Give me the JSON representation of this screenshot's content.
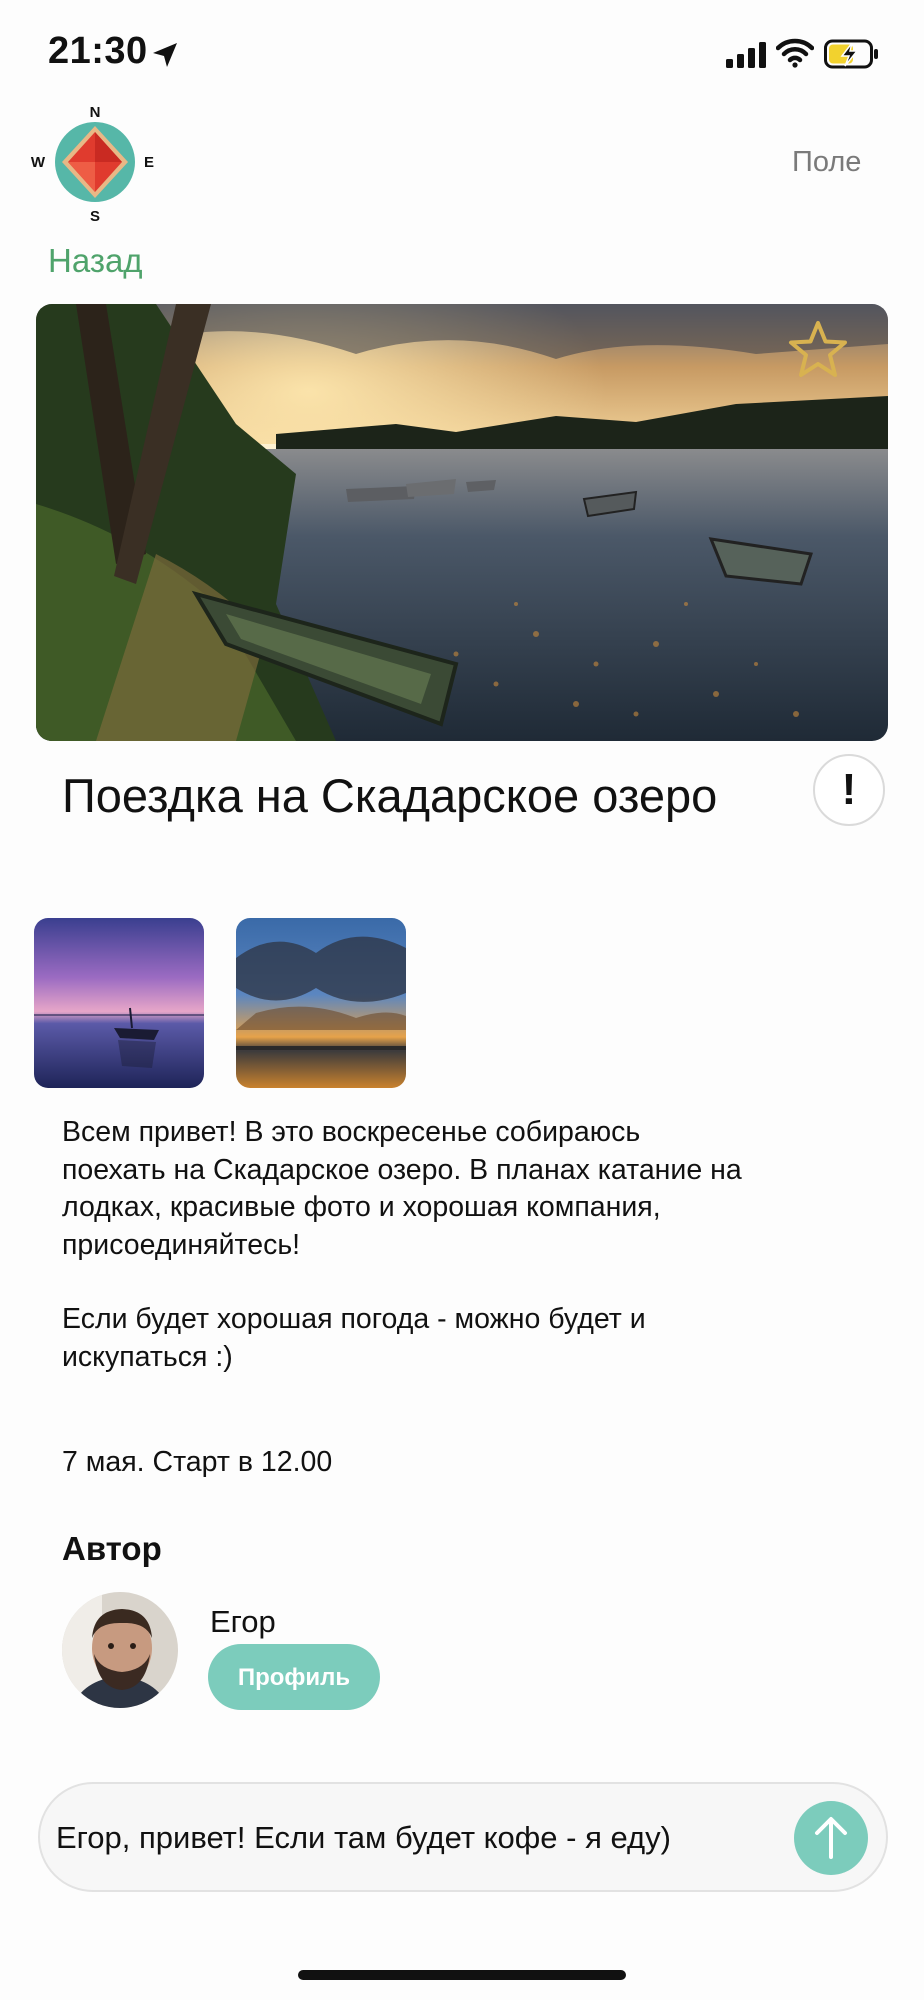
{
  "status_bar": {
    "time": "21:30",
    "location_icon": "location-arrow-icon",
    "signal_icon": "cellular-signal-icon",
    "wifi_icon": "wifi-icon",
    "battery_icon": "battery-charging-icon"
  },
  "header": {
    "compass": {
      "north": "N",
      "south": "S",
      "west": "W",
      "east": "E"
    },
    "field_link": "Поле",
    "back_link": "Назад"
  },
  "hero": {
    "favorite_icon": "star-outline-icon"
  },
  "post": {
    "title": "Поездка на Скадарское озеро",
    "report_label": "!",
    "description_p1": "Всем привет! В это воскресенье собираюсь поехать на Скадарское озеро. В планах катание на лодках, красивые фото и хорошая компания, присоединяйтесь!",
    "description_p2": "Если будет хорошая погода - можно будет и искупаться :)",
    "date": "7 мая. Старт в 12.00"
  },
  "author": {
    "heading": "Автор",
    "name": "Егор",
    "profile_button": "Профиль"
  },
  "composer": {
    "message": "Егор, привет! Если там будет кофе - я еду)",
    "send_icon": "arrow-up-icon"
  },
  "colors": {
    "accent_green": "#4fa36b",
    "teal": "#7cccbc",
    "star_gold": "#d8b250",
    "compass_red": "#e03b2e"
  }
}
